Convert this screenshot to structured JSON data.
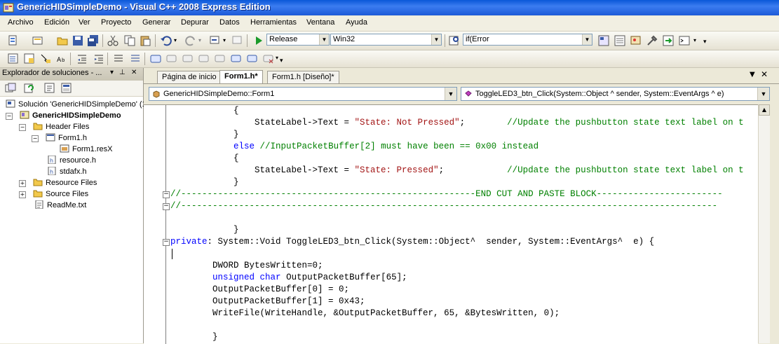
{
  "window": {
    "title": "GenericHIDSimpleDemo - Visual C++ 2008 Express Edition"
  },
  "menu": [
    "Archivo",
    "Edición",
    "Ver",
    "Proyecto",
    "Generar",
    "Depurar",
    "Datos",
    "Herramientas",
    "Ventana",
    "Ayuda"
  ],
  "toolbar": {
    "config_combo": "Release",
    "platform_combo": "Win32",
    "find_combo": "if(Error"
  },
  "solution_explorer": {
    "title": "Explorador de soluciones - ...",
    "pin_icon": "pin-icon",
    "close_icon": "close-icon",
    "solution": "Solución 'GenericHIDSimpleDemo' (1",
    "project": "GenericHIDSimpleDemo",
    "nodes": {
      "header_files": "Header Files",
      "form1_h": "Form1.h",
      "form1_resx": "Form1.resX",
      "resource_h": "resource.h",
      "stdafx_h": "stdafx.h",
      "resource_files": "Resource Files",
      "source_files": "Source Files",
      "readme": "ReadMe.txt"
    }
  },
  "editor": {
    "tabs": [
      "Página de inicio",
      "Form1.h*",
      "Form1.h [Diseño]*"
    ],
    "active_tab": "Form1.h*",
    "scope_combo": "GenericHIDSimpleDemo::Form1",
    "member_combo": "ToggleLED3_btn_Click(System::Object ^ sender, System::EventArgs ^ e)"
  },
  "code_lines": [
    {
      "parts": [
        {
          "t": "            {",
          "c": ""
        }
      ]
    },
    {
      "parts": [
        {
          "t": "                StateLabel->Text = ",
          "c": ""
        },
        {
          "t": "\"State: Not Pressed\"",
          "c": "str"
        },
        {
          "t": ";        ",
          "c": ""
        },
        {
          "t": "//Update the pushbutton state text label on t",
          "c": "cm"
        }
      ]
    },
    {
      "parts": [
        {
          "t": "            }",
          "c": ""
        }
      ]
    },
    {
      "parts": [
        {
          "t": "            ",
          "c": ""
        },
        {
          "t": "else",
          "c": "kw"
        },
        {
          "t": " ",
          "c": ""
        },
        {
          "t": "//InputPacketBuffer[2] must have been == 0x00 instead",
          "c": "cm"
        }
      ]
    },
    {
      "parts": [
        {
          "t": "            {",
          "c": ""
        }
      ]
    },
    {
      "parts": [
        {
          "t": "                StateLabel->Text = ",
          "c": ""
        },
        {
          "t": "\"State: Pressed\"",
          "c": "str"
        },
        {
          "t": ";            ",
          "c": ""
        },
        {
          "t": "//Update the pushbutton state text label on t",
          "c": "cm"
        }
      ]
    },
    {
      "parts": [
        {
          "t": "            }",
          "c": ""
        }
      ]
    },
    {
      "parts": [
        {
          "t": "//--------------------------------------------------------END CUT AND PASTE BLOCK------------------------",
          "c": "cm"
        }
      ]
    },
    {
      "parts": [
        {
          "t": "//------------------------------------------------------------------------------------------------------",
          "c": "cm"
        }
      ]
    },
    {
      "parts": [
        {
          "t": "",
          "c": ""
        }
      ]
    },
    {
      "parts": [
        {
          "t": "            }",
          "c": ""
        }
      ]
    },
    {
      "parts": [
        {
          "t": "private",
          "c": "kw"
        },
        {
          "t": ": System::Void ToggleLED3_btn_Click(System::Object^  sender, System::EventArgs^  e) {",
          "c": ""
        }
      ]
    },
    {
      "parts": [
        {
          "t": "",
          "c": ""
        }
      ]
    },
    {
      "parts": [
        {
          "t": "        DWORD BytesWritten=0;",
          "c": ""
        }
      ]
    },
    {
      "parts": [
        {
          "t": "        ",
          "c": ""
        },
        {
          "t": "unsigned",
          "c": "kw"
        },
        {
          "t": " ",
          "c": ""
        },
        {
          "t": "char",
          "c": "kw"
        },
        {
          "t": " OutputPacketBuffer[65];",
          "c": ""
        }
      ]
    },
    {
      "parts": [
        {
          "t": "        OutputPacketBuffer[0] = 0;",
          "c": ""
        }
      ]
    },
    {
      "parts": [
        {
          "t": "        OutputPacketBuffer[1] = 0x43;",
          "c": ""
        }
      ]
    },
    {
      "parts": [
        {
          "t": "        WriteFile(WriteHandle, &OutputPacketBuffer, 65, &BytesWritten, 0);",
          "c": ""
        }
      ]
    },
    {
      "parts": [
        {
          "t": "",
          "c": ""
        }
      ]
    },
    {
      "parts": [
        {
          "t": "        }",
          "c": ""
        }
      ]
    }
  ]
}
